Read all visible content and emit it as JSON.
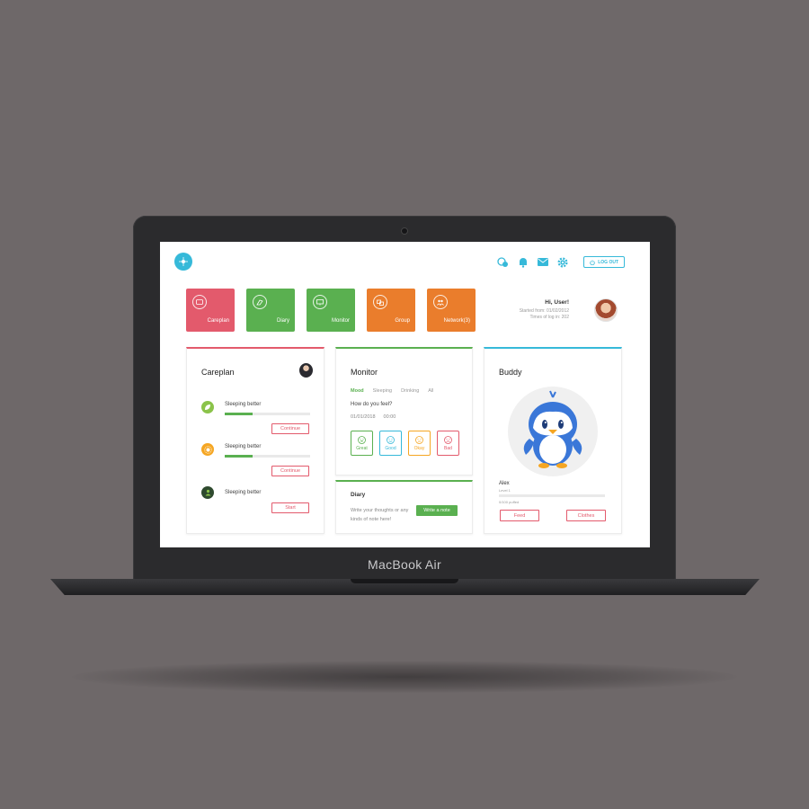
{
  "device": {
    "brand": "MacBook Air"
  },
  "header": {
    "logout_label": "LOG OUT"
  },
  "tiles": [
    {
      "label": "Careplan",
      "color": "#e35a6c"
    },
    {
      "label": "Diary",
      "color": "#5ab050"
    },
    {
      "label": "Monitor",
      "color": "#5ab050"
    },
    {
      "label": "Group",
      "color": "#ea7d2c"
    },
    {
      "label": "Network(3)",
      "color": "#ea7d2c"
    }
  ],
  "user": {
    "greeting": "Hi, User!",
    "started": "Started from: 01/02/2012",
    "times": "Times of log in: 202"
  },
  "careplan": {
    "title": "Careplan",
    "goals": [
      {
        "text": "Sleeping better",
        "progress": 0.33,
        "button": "Continue",
        "icon": "leaf-icon",
        "color": "#8bc34a"
      },
      {
        "text": "Sleeping better",
        "progress": 0.33,
        "button": "Continue",
        "icon": "sun-icon",
        "color": "#f5a623"
      },
      {
        "text": "Sleeping better",
        "progress": 0,
        "button": "Start",
        "icon": "people-icon",
        "color": "#2e4a2e"
      }
    ]
  },
  "monitor": {
    "title": "Monitor",
    "tabs": [
      "Mood",
      "Sleeping",
      "Drinking",
      "All"
    ],
    "question": "How do you feel?",
    "date": "01/01/2018",
    "time": "00:00",
    "moods": [
      {
        "label": "Great",
        "color": "#5ab050",
        "icon": "happy-face-icon"
      },
      {
        "label": "Good",
        "color": "#36b9d9",
        "icon": "smile-face-icon"
      },
      {
        "label": "Okay",
        "color": "#f5a623",
        "icon": "neutral-face-icon"
      },
      {
        "label": "Bad",
        "color": "#e35a6c",
        "icon": "sad-face-icon"
      }
    ]
  },
  "diary": {
    "title": "Diary",
    "prompt": "Write your thoughts or any kinds of note here!",
    "button": "Write a note"
  },
  "buddy": {
    "title": "Buddy",
    "name": "Alex",
    "level": "Level 1",
    "puffed": "0/100 puffed",
    "feed": "Feed",
    "clothes": "Clothes"
  }
}
